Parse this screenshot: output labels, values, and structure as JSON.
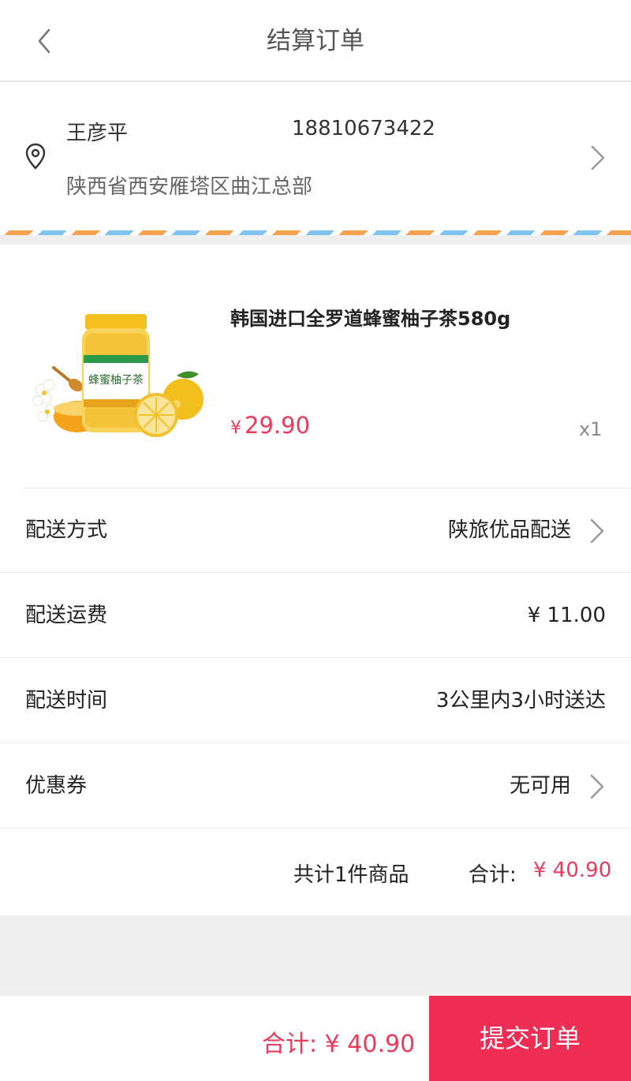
{
  "header": {
    "title": "结算订单"
  },
  "address": {
    "name": "王彦平",
    "phone": "18810673422",
    "detail": "陕西省西安雁塔区曲江总部"
  },
  "product": {
    "name": "韩国进口全罗道蜂蜜柚子茶580g",
    "currency": "¥",
    "price": "29.90",
    "quantity": "x1",
    "image_label": "蜂蜜柚子茶"
  },
  "rows": [
    {
      "label": "配送方式",
      "value": "陕旅优品配送",
      "chevron": true
    },
    {
      "label": "配送运费",
      "value": "¥ 11.00",
      "chevron": false
    },
    {
      "label": "配送时间",
      "value": "3公里内3小时送达",
      "chevron": false
    },
    {
      "label": "优惠券",
      "value": "无可用",
      "chevron": true
    }
  ],
  "summary": {
    "count_text": "共计1件商品",
    "total_label": "合计:",
    "total_value": "¥ 40.90"
  },
  "footer": {
    "total_text": "合计: ¥ 40.90",
    "submit_label": "提交订单"
  },
  "colors": {
    "accent": "#ee2d55",
    "price": "#ea3b5c",
    "airmail_orange": "#f7a24f",
    "airmail_blue": "#7fc3ee"
  }
}
